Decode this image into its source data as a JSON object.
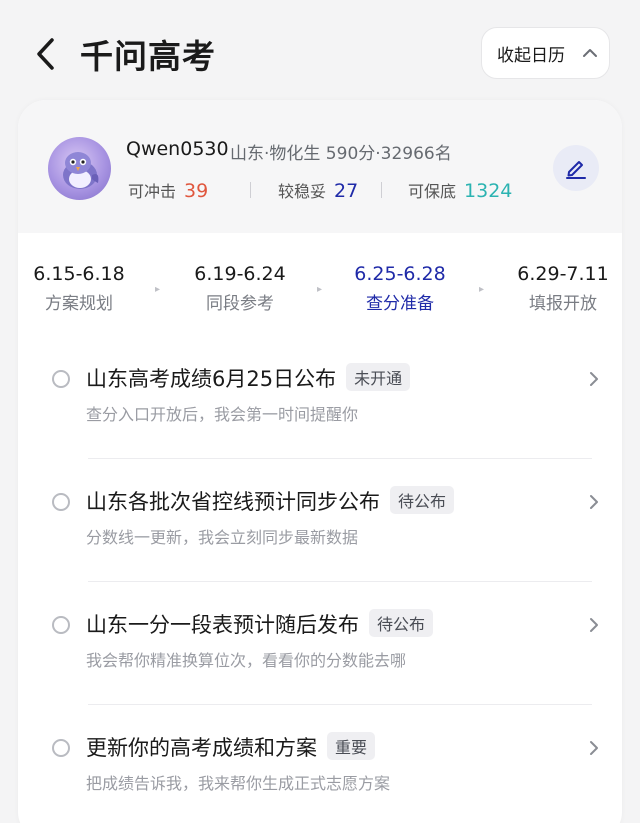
{
  "header": {
    "title": "千问高考",
    "collapse_label": "收起日历"
  },
  "profile": {
    "username": "Qwen0530",
    "meta": "山东·物化生 590分·32966名",
    "stats": [
      {
        "label": "可冲击",
        "value": "39",
        "color": "#e0573e"
      },
      {
        "label": "较稳妥",
        "value": "27",
        "color": "#1f2aa8"
      },
      {
        "label": "可保底",
        "value": "1324",
        "color": "#2bb3b1"
      }
    ]
  },
  "timeline": {
    "phases": [
      {
        "dates": "6.15-6.18",
        "name": "方案规划",
        "active": false
      },
      {
        "dates": "6.19-6.24",
        "name": "同段参考",
        "active": false
      },
      {
        "dates": "6.25-6.28",
        "name": "查分准备",
        "active": true
      },
      {
        "dates": "6.29-7.11",
        "name": "填报开放",
        "active": false
      }
    ],
    "active_color": "#1f2aa8"
  },
  "items": [
    {
      "title": "山东高考成绩6月25日公布",
      "badge": "未开通",
      "desc": "查分入口开放后，我会第一时间提醒你"
    },
    {
      "title": "山东各批次省控线预计同步公布",
      "badge": "待公布",
      "desc": "分数线一更新，我会立刻同步最新数据"
    },
    {
      "title": "山东一分一段表预计随后发布",
      "badge": "待公布",
      "desc": "我会帮你精准换算位次，看看你的分数能去哪"
    },
    {
      "title": "更新你的高考成绩和方案",
      "badge": "重要",
      "desc": "把成绩告诉我，我来帮你生成正式志愿方案"
    }
  ],
  "icons": {
    "back": "chevron-left-icon",
    "collapse": "chevron-up-icon",
    "edit": "pencil-icon",
    "item_arrow": "chevron-right-icon"
  }
}
